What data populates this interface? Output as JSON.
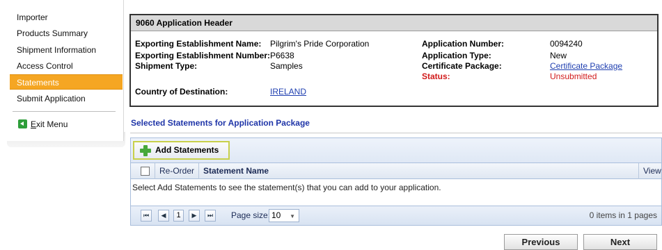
{
  "sidebar": {
    "items": [
      {
        "label": "Importer"
      },
      {
        "label": "Products Summary"
      },
      {
        "label": "Shipment Information"
      },
      {
        "label": "Access Control"
      },
      {
        "label": "Statements",
        "active": true
      },
      {
        "label": "Submit Application"
      }
    ],
    "exit_label_underlined": "E",
    "exit_label_rest": "xit Menu",
    "exit_icon": "exit-arrow-icon",
    "active_color": "#f5a623"
  },
  "header": {
    "title": "9060 Application Header",
    "exporting_name_label": "Exporting Establishment Name:",
    "exporting_name_value": "Pilgrim's Pride Corporation",
    "exporting_number_label": "Exporting Establishment Number:",
    "exporting_number_value": "P6638",
    "shipment_type_label": "Shipment Type:",
    "shipment_type_value": "Samples",
    "country_label": "Country of Destination:",
    "country_value": "IRELAND",
    "app_number_label": "Application Number:",
    "app_number_value": "0094240",
    "app_type_label": "Application Type:",
    "app_type_value": "New",
    "cert_package_label": "Certificate Package:",
    "cert_package_value": "Certificate Package",
    "status_label": "Status:",
    "status_value": "Unsubmitted",
    "status_color": "#d11a1a"
  },
  "statements": {
    "section_title": "Selected Statements for Application Package",
    "add_button": "Add Statements",
    "columns": {
      "reorder": "Re-Order",
      "name": "Statement Name",
      "view": "View"
    },
    "empty_message": "Select Add Statements to see the statement(s) that you can add to your application.",
    "pager": {
      "first": "⏮",
      "prev": "◀",
      "page": "1",
      "next": "▶",
      "last": "⏭",
      "page_size_label": "Page size:",
      "page_size_value": "10",
      "info": "0 items in 1 pages"
    }
  },
  "nav": {
    "previous": "Previous",
    "next": "Next"
  }
}
